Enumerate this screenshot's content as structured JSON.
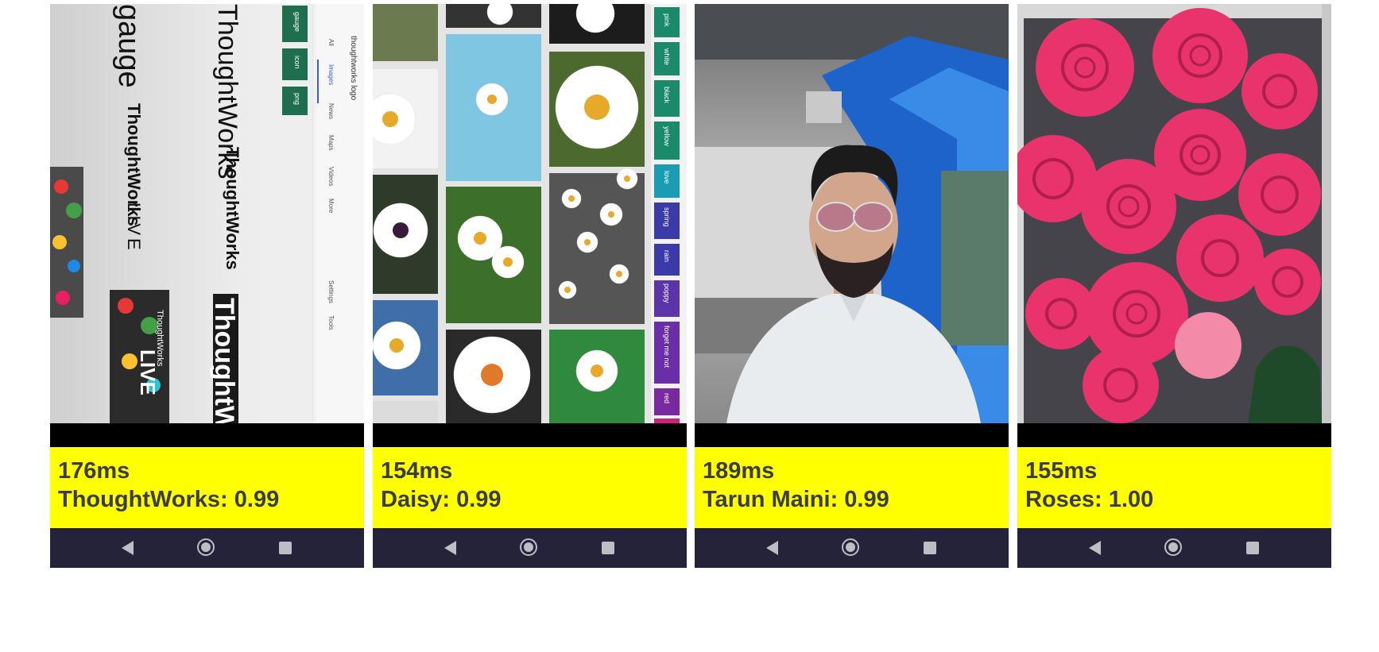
{
  "panels": [
    {
      "time": "176ms",
      "label": "ThoughtWorks: 0.99",
      "photo": {
        "search_query": "thoughtworks logo",
        "tabs": [
          "All",
          "Images",
          "News",
          "Maps",
          "Videos",
          "More"
        ],
        "side_links": [
          "Settings",
          "Tools"
        ],
        "chips": [
          "gauge",
          "icon",
          "png"
        ],
        "logo_texts": [
          "gauge",
          "ThoughtWorks",
          "ThoughtWorks",
          "ThoughtWorks",
          "LIVE",
          "ThoughtWorks",
          "LIVE",
          "ThoughtWo"
        ]
      }
    },
    {
      "time": "154ms",
      "label": "Daisy: 0.99",
      "photo": {
        "chips": [
          "pink",
          "white",
          "black",
          "yellow",
          "love",
          "spring",
          "rain",
          "poppy",
          "forget me not",
          "red"
        ]
      }
    },
    {
      "time": "189ms",
      "label": "Tarun Maini: 0.99"
    },
    {
      "time": "155ms",
      "label": "Roses: 1.00"
    }
  ],
  "colors": {
    "result_bg": "#ffff00",
    "result_text": "#3a3d49",
    "nav_bg": "#24233a",
    "nav_icons": "#bdbdc6"
  },
  "icons": [
    "back-triangle-icon",
    "home-circle-icon",
    "recents-square-icon"
  ]
}
